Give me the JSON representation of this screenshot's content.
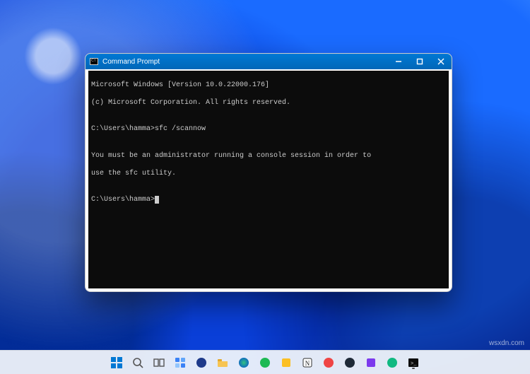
{
  "window": {
    "title": "Command Prompt",
    "controls": {
      "minimize": "—",
      "maximize": "▢",
      "close": "✕"
    },
    "lines": {
      "l0": "Microsoft Windows [Version 10.0.22000.176]",
      "l1": "(c) Microsoft Corporation. All rights reserved.",
      "l2_prompt": "C:\\Users\\hamma>",
      "l2_cmd": "sfc /scannow",
      "l3": "You must be an administrator running a console session in order to",
      "l4": "use the sfc utility.",
      "l5_prompt": "C:\\Users\\hamma>"
    }
  },
  "colors": {
    "titlebar": "#0078d4",
    "console_bg": "#0c0c0c",
    "console_fg": "#cccccc"
  },
  "watermark": "wsxdn.com"
}
